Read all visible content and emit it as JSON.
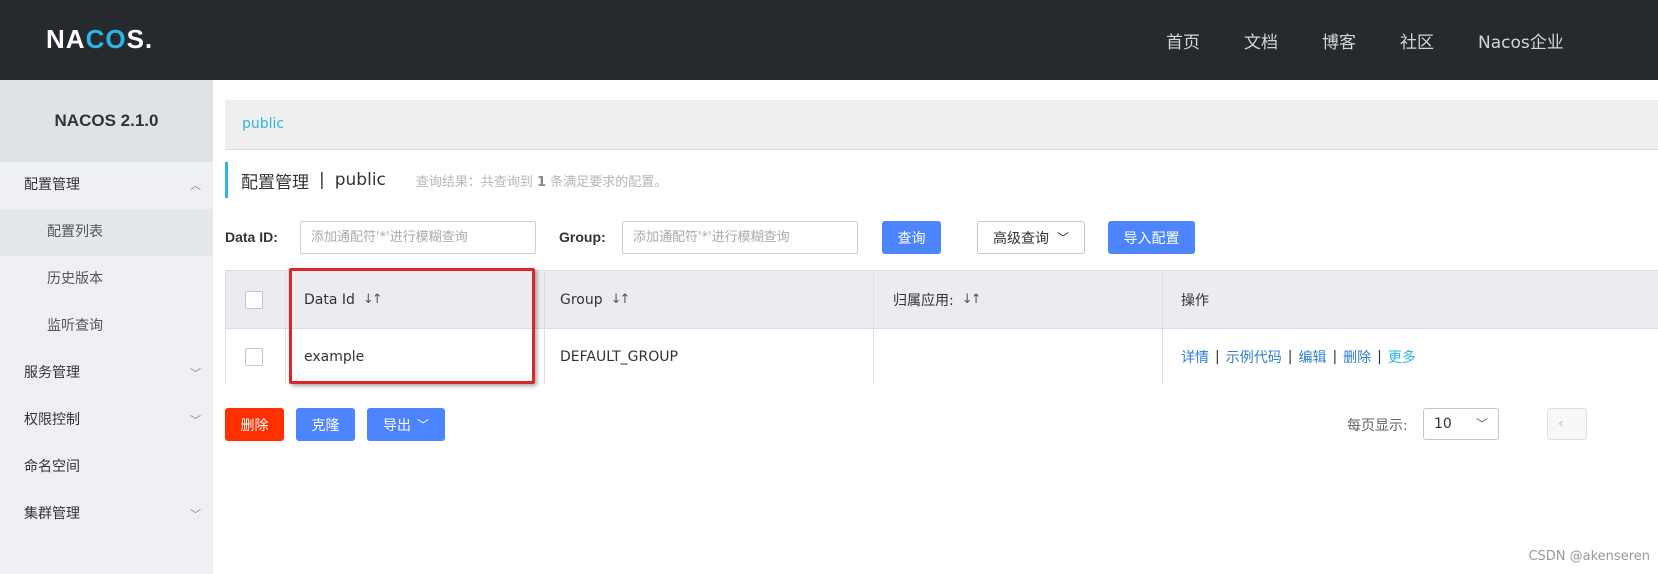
{
  "header": {
    "logo_prefix": "NA",
    "logo_mid": "CO",
    "logo_suffix": "S.",
    "nav": [
      "首页",
      "文档",
      "博客",
      "社区",
      "Nacos企业"
    ]
  },
  "sidebar": {
    "version": "NACOS 2.1.0",
    "items": [
      {
        "label": "配置管理",
        "chevron": "up"
      },
      {
        "label": "配置列表"
      },
      {
        "label": "历史版本"
      },
      {
        "label": "监听查询"
      },
      {
        "label": "服务管理",
        "chevron": "down"
      },
      {
        "label": "权限控制",
        "chevron": "down"
      },
      {
        "label": "命名空间"
      },
      {
        "label": "集群管理",
        "chevron": "down"
      }
    ]
  },
  "breadcrumb": {
    "namespace": "public"
  },
  "page": {
    "title": "配置管理",
    "separator": "|",
    "namespace": "public",
    "result_prefix": "查询结果：共查询到",
    "result_count": "1",
    "result_suffix": "条满足要求的配置。"
  },
  "filter": {
    "dataid_label": "Data ID:",
    "dataid_placeholder": "添加通配符'*'进行模糊查询",
    "group_label": "Group:",
    "group_placeholder": "添加通配符'*'进行模糊查询",
    "query_button": "查询",
    "advanced_button": "高级查询",
    "import_button": "导入配置"
  },
  "table": {
    "columns": [
      "Data Id",
      "Group",
      "归属应用:",
      "操作"
    ],
    "rows": [
      {
        "data_id": "example",
        "group": "DEFAULT_GROUP",
        "app": "",
        "ops": [
          "详情",
          "示例代码",
          "编辑",
          "删除",
          "更多"
        ]
      }
    ]
  },
  "actions": {
    "delete_button": "删除",
    "clone_button": "克隆",
    "export_button": "导出"
  },
  "pager": {
    "page_size_label": "每页显示:",
    "page_size": "10"
  },
  "watermark": "CSDN @akenseren",
  "colors": {
    "header_bg": "#252a2f",
    "accent": "#2bb6e6",
    "primary": "#4d84ff",
    "danger": "#ff3000",
    "highlight": "#d9272e"
  }
}
